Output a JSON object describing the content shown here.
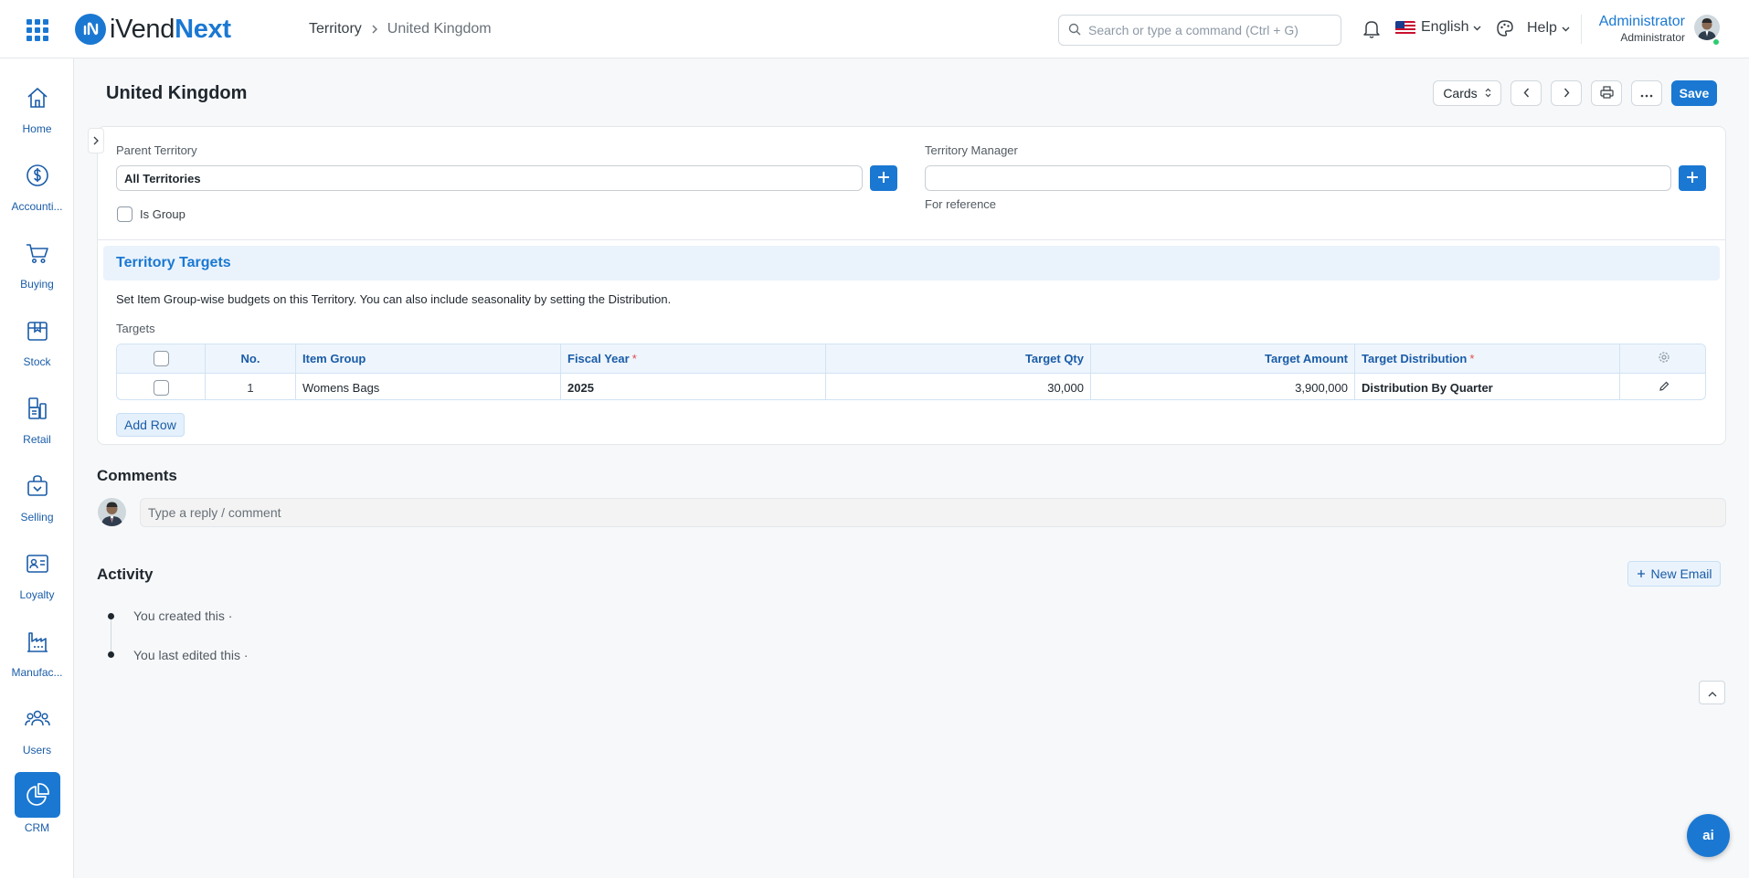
{
  "app": {
    "brand_prefix": "iVend",
    "brand_suffix": "Next",
    "brand_color": "#1a78d2"
  },
  "breadcrumb": {
    "parent": "Territory",
    "current": "United Kingdom"
  },
  "search": {
    "placeholder": "Search or type a command (Ctrl + G)"
  },
  "navbar": {
    "language": "English",
    "help": "Help",
    "user_name": "Administrator",
    "user_role": "Administrator"
  },
  "sidebar": {
    "items": [
      {
        "label": "Home",
        "icon": "home-icon"
      },
      {
        "label": "Accounti...",
        "icon": "dollar-icon"
      },
      {
        "label": "Buying",
        "icon": "cart-icon"
      },
      {
        "label": "Stock",
        "icon": "box-icon"
      },
      {
        "label": "Retail",
        "icon": "pos-icon"
      },
      {
        "label": "Selling",
        "icon": "shopping-bag-icon"
      },
      {
        "label": "Loyalty",
        "icon": "id-card-icon"
      },
      {
        "label": "Manufac...",
        "icon": "factory-icon"
      },
      {
        "label": "Users",
        "icon": "users-icon"
      },
      {
        "label": "CRM",
        "icon": "pie-chart-icon",
        "active": true
      }
    ]
  },
  "page": {
    "title": "United Kingdom",
    "view_select": "Cards",
    "save_label": "Save"
  },
  "form": {
    "parent_territory_label": "Parent Territory",
    "parent_territory_value": "All Territories",
    "is_group_label": "Is Group",
    "is_group_checked": false,
    "territory_manager_label": "Territory Manager",
    "territory_manager_value": "",
    "territory_manager_help": "For reference"
  },
  "targets_section": {
    "title": "Territory Targets",
    "description": "Set Item Group-wise budgets on this Territory. You can also include seasonality by setting the Distribution.",
    "table_label": "Targets",
    "columns": {
      "no": "No.",
      "item_group": "Item Group",
      "fiscal_year": "Fiscal Year",
      "target_qty": "Target Qty",
      "target_amount": "Target Amount",
      "target_distribution": "Target Distribution"
    },
    "required_marker": "*",
    "rows": [
      {
        "no": "1",
        "item_group": "Womens Bags",
        "fiscal_year": "2025",
        "target_qty": "30,000",
        "target_amount": "3,900,000",
        "target_distribution": "Distribution By Quarter"
      }
    ],
    "add_row_label": "Add Row"
  },
  "comments": {
    "title": "Comments",
    "placeholder": "Type a reply / comment"
  },
  "activity": {
    "title": "Activity",
    "new_email_label": "New Email",
    "items": [
      "You created this ·",
      "You last edited this ·"
    ]
  },
  "ai_button_label": "ai"
}
